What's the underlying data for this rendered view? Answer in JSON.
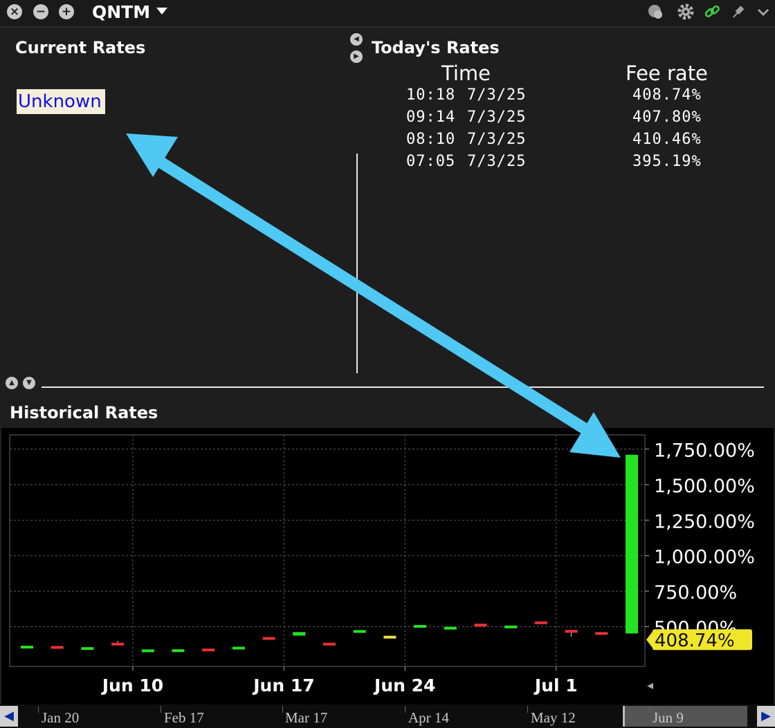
{
  "window": {
    "symbol": "QNTM"
  },
  "current_rates": {
    "title": "Current Rates",
    "value": "Unknown"
  },
  "todays_rates": {
    "title": "Today's Rates",
    "headers": {
      "time": "Time",
      "fee_rate": "Fee rate"
    },
    "rows": [
      {
        "time": "10:18",
        "date": "7/3/25",
        "rate": "408.74%"
      },
      {
        "time": "09:14",
        "date": "7/3/25",
        "rate": "407.80%"
      },
      {
        "time": "08:10",
        "date": "7/3/25",
        "rate": "410.46%"
      },
      {
        "time": "07:05",
        "date": "7/3/25",
        "rate": "395.19%"
      }
    ]
  },
  "historical": {
    "title": "Historical Rates"
  },
  "nav_strip": {
    "labels": [
      "Jan 20",
      "Feb 17",
      "Mar 17",
      "Apr 14",
      "May 12",
      "Jun 9"
    ]
  },
  "colors": {
    "up": "#22e222",
    "down": "#e8303a",
    "flat": "#f0e040",
    "annotation_arrow": "#4fc8f4",
    "last_label_bg": "#f0e62a"
  },
  "chart_data": {
    "type": "candlestick",
    "ylim": [
      220,
      1850
    ],
    "yticks": [
      500,
      750,
      1000,
      1250,
      1500,
      1750
    ],
    "ytick_labels": [
      "500.00%",
      "750.00%",
      "1,000.00%",
      "1,250.00%",
      "1,500.00%",
      "1,750.00%"
    ],
    "xtick_labels": [
      "Jun 10",
      "Jun 17",
      "Jun 24",
      "Jul 1"
    ],
    "xtick_index": [
      3.5,
      8.5,
      12.5,
      17.5
    ],
    "last_value_label": "408.74%",
    "last_value": 408.74,
    "bars": [
      {
        "open": 356,
        "close": 366,
        "high": 366,
        "low": 356,
        "dir": "up"
      },
      {
        "open": 364,
        "close": 354,
        "high": 364,
        "low": 354,
        "dir": "down"
      },
      {
        "open": 346,
        "close": 356,
        "high": 356,
        "low": 346,
        "dir": "up"
      },
      {
        "open": 387,
        "close": 377,
        "high": 400,
        "low": 377,
        "dir": "down"
      },
      {
        "open": 330,
        "close": 340,
        "high": 340,
        "low": 330,
        "dir": "up"
      },
      {
        "open": 331,
        "close": 341,
        "high": 341,
        "low": 331,
        "dir": "up"
      },
      {
        "open": 346,
        "close": 336,
        "high": 346,
        "low": 336,
        "dir": "down"
      },
      {
        "open": 349,
        "close": 359,
        "high": 359,
        "low": 349,
        "dir": "up"
      },
      {
        "open": 427,
        "close": 417,
        "high": 427,
        "low": 417,
        "dir": "down"
      },
      {
        "open": 437,
        "close": 462,
        "high": 462,
        "low": 437,
        "dir": "up"
      },
      {
        "open": 387,
        "close": 377,
        "high": 387,
        "low": 377,
        "dir": "down"
      },
      {
        "open": 466,
        "close": 476,
        "high": 476,
        "low": 466,
        "dir": "up"
      },
      {
        "open": 426,
        "close": 436,
        "high": 436,
        "low": 426,
        "dir": "flat"
      },
      {
        "open": 502,
        "close": 512,
        "high": 512,
        "low": 502,
        "dir": "up"
      },
      {
        "open": 489,
        "close": 499,
        "high": 499,
        "low": 489,
        "dir": "up"
      },
      {
        "open": 521,
        "close": 511,
        "high": 521,
        "low": 511,
        "dir": "down"
      },
      {
        "open": 498,
        "close": 508,
        "high": 508,
        "low": 498,
        "dir": "up"
      },
      {
        "open": 537,
        "close": 527,
        "high": 537,
        "low": 521,
        "dir": "down"
      },
      {
        "open": 477,
        "close": 467,
        "high": 477,
        "low": 430,
        "dir": "down"
      },
      {
        "open": 462,
        "close": 452,
        "high": 462,
        "low": 452,
        "dir": "down"
      },
      {
        "open": 452,
        "close": 1710,
        "high": 1710,
        "low": 452,
        "dir": "up"
      }
    ]
  }
}
